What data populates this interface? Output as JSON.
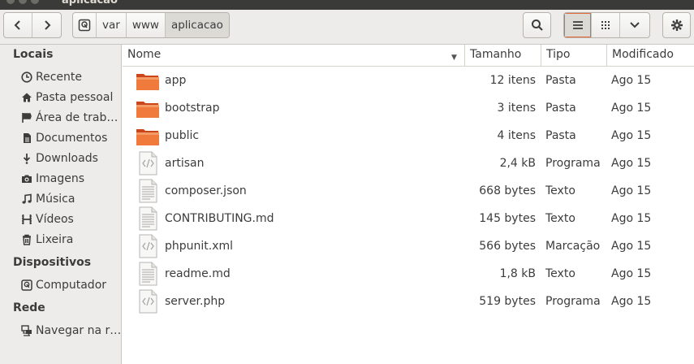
{
  "window": {
    "title": "aplicacao"
  },
  "toolbar": {
    "back_icon": "chevron-left-icon",
    "forward_icon": "chevron-right-icon",
    "breadcrumb": [
      "var",
      "www",
      "aplicacao"
    ],
    "search_icon": "search-icon",
    "view_list_icon": "list-view-icon",
    "view_grid_icon": "grid-view-icon",
    "view_menu_icon": "chevron-down-icon",
    "settings_icon": "gear-icon",
    "active_view": "list"
  },
  "sidebar": {
    "sections": [
      {
        "title": "Locais"
      },
      {
        "title": "Dispositivos"
      },
      {
        "title": "Rede"
      }
    ],
    "items": [
      {
        "label": "Recente",
        "icon": "clock-icon"
      },
      {
        "label": "Pasta pessoal",
        "icon": "home-icon"
      },
      {
        "label": "Área de trab…",
        "icon": "desktop-icon"
      },
      {
        "label": "Documentos",
        "icon": "document-icon"
      },
      {
        "label": "Downloads",
        "icon": "download-icon"
      },
      {
        "label": "Imagens",
        "icon": "camera-icon"
      },
      {
        "label": "Música",
        "icon": "music-icon"
      },
      {
        "label": "Vídeos",
        "icon": "film-icon"
      },
      {
        "label": "Lixeira",
        "icon": "trash-icon"
      },
      {
        "label": "Computador",
        "icon": "drive-icon"
      },
      {
        "label": "Navegar na r…",
        "icon": "network-icon"
      }
    ]
  },
  "columns": [
    "Nome",
    "Tamanho",
    "Tipo",
    "Modificado"
  ],
  "files": [
    {
      "name": "app",
      "size": "12 itens",
      "type": "Pasta",
      "modified": "Ago 15",
      "icon": "folder-icon"
    },
    {
      "name": "bootstrap",
      "size": "3 itens",
      "type": "Pasta",
      "modified": "Ago 15",
      "icon": "folder-icon"
    },
    {
      "name": "public",
      "size": "4 itens",
      "type": "Pasta",
      "modified": "Ago 15",
      "icon": "folder-icon"
    },
    {
      "name": "artisan",
      "size": "2,4 kB",
      "type": "Programa",
      "modified": "Ago 15",
      "icon": "code-file-icon"
    },
    {
      "name": "composer.json",
      "size": "668 bytes",
      "type": "Texto",
      "modified": "Ago 15",
      "icon": "text-file-icon"
    },
    {
      "name": "CONTRIBUTING.md",
      "size": "145 bytes",
      "type": "Texto",
      "modified": "Ago 15",
      "icon": "text-file-icon"
    },
    {
      "name": "phpunit.xml",
      "size": "566 bytes",
      "type": "Marcação",
      "modified": "Ago 15",
      "icon": "code-file-icon"
    },
    {
      "name": "readme.md",
      "size": "1,8 kB",
      "type": "Texto",
      "modified": "Ago 15",
      "icon": "text-file-icon"
    },
    {
      "name": "server.php",
      "size": "519 bytes",
      "type": "Programa",
      "modified": "Ago 15",
      "icon": "code-file-icon"
    }
  ],
  "colors": {
    "folder": "#e95420",
    "accent": "#e36a36",
    "sidebar_bg": "#edeceb"
  }
}
